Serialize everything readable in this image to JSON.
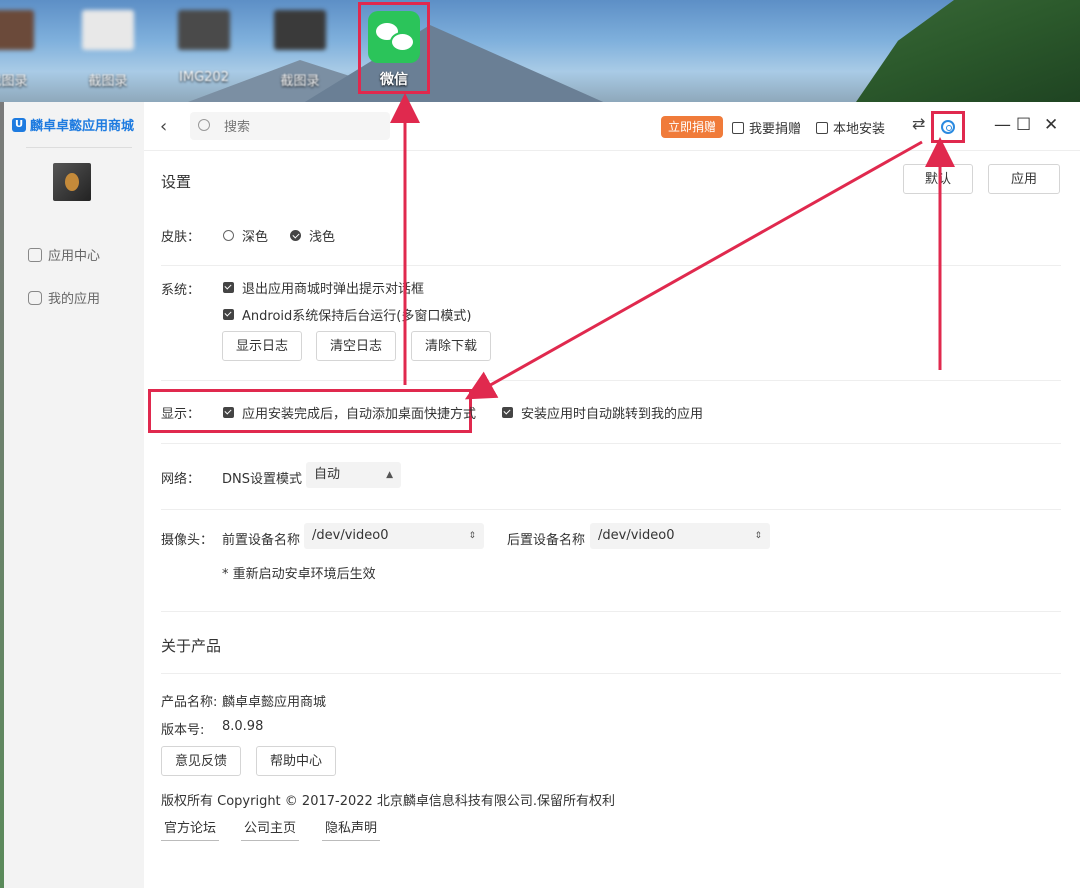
{
  "desktop": {
    "icons": [
      {
        "label": "截图录"
      },
      {
        "label": "截图录"
      },
      {
        "label": "IMG202"
      },
      {
        "label": "截图录"
      }
    ],
    "wechat_label": "微信"
  },
  "sidebar": {
    "app_name": "麟卓卓懿应用商城",
    "items": [
      {
        "label": "应用中心",
        "icon": "grid-icon"
      },
      {
        "label": "我的应用",
        "icon": "bag-icon"
      }
    ]
  },
  "topbar": {
    "search_placeholder": "搜索",
    "donate_now": "立即捐赠",
    "donate": "我要捐赠",
    "local_install": "本地安装",
    "minimize": "—",
    "maximize": "☐",
    "close": "✕"
  },
  "settings": {
    "title": "设置",
    "default_btn": "默认",
    "apply_btn": "应用",
    "skin": {
      "label": "皮肤：",
      "options": [
        {
          "label": "深色",
          "selected": false
        },
        {
          "label": "浅色",
          "selected": true
        }
      ]
    },
    "system": {
      "label": "系统：",
      "checks": [
        "退出应用商城时弹出提示对话框",
        "Android系统保持后台运行(多窗口模式)"
      ],
      "buttons": [
        "显示日志",
        "清空日志",
        "清除下载"
      ]
    },
    "display": {
      "label": "显示：",
      "checks": [
        "应用安装完成后，自动添加桌面快捷方式",
        "安装应用时自动跳转到我的应用"
      ]
    },
    "network": {
      "label": "网络：",
      "dns_label": "DNS设置模式",
      "dns_value": "自动"
    },
    "camera": {
      "label": "摄像头：",
      "front_label": "前置设备名称",
      "front_value": "/dev/video0",
      "rear_label": "后置设备名称",
      "rear_value": "/dev/video0",
      "note": "* 重新启动安卓环境后生效"
    }
  },
  "about": {
    "title": "关于产品",
    "name_label": "产品名称:",
    "name_value": "麟卓卓懿应用商城",
    "version_label": "版本号:",
    "version_value": "8.0.98",
    "feedback_btn": "意见反馈",
    "help_btn": "帮助中心",
    "copyright": "版权所有 Copyright © 2017-2022 北京麟卓信息科技有限公司.保留所有权利",
    "links": [
      "官方论坛",
      "公司主页",
      "隐私声明"
    ]
  },
  "colors": {
    "highlight": "#e0294e",
    "brand": "#1e7be0",
    "donate": "#f07b3a",
    "wechat": "#2bc45a"
  }
}
